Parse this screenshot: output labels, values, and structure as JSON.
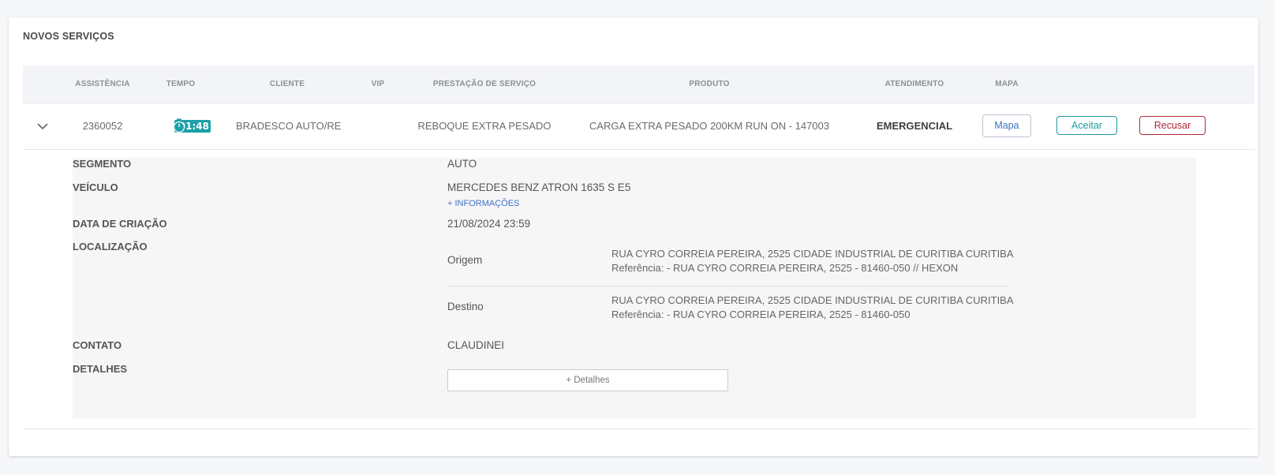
{
  "section_title": "NOVOS SERVIÇOS",
  "table": {
    "headers": {
      "assistencia": "ASSISTÊNCIA",
      "tempo": "TEMPO",
      "cliente": "CLIENTE",
      "vip": "VIP",
      "prestacao": "PRESTAÇÃO DE SERVIÇO",
      "produto": "PRODUTO",
      "atendimento": "ATENDIMENTO",
      "mapa": "MAPA"
    },
    "row": {
      "assistencia": "2360052",
      "tempo": "01:48",
      "cliente": "BRADESCO AUTO/RE",
      "vip": "",
      "prestacao": "REBOQUE EXTRA PESADO",
      "produto": "CARGA EXTRA PESADO 200KM RUN ON - 147003",
      "atendimento": "EMERGENCIAL",
      "mapa_button": "Mapa",
      "aceitar_button": "Aceitar",
      "recusar_button": "Recusar"
    }
  },
  "details": {
    "segmento_label": "SEGMENTO",
    "segmento_value": "AUTO",
    "veiculo_label": "VEÍCULO",
    "veiculo_value": "MERCEDES BENZ ATRON 1635 S E5",
    "more_info_link": "+ INFORMAÇÕES",
    "data_criacao_label": "DATA DE CRIAÇÃO",
    "data_criacao_value": "21/08/2024 23:59",
    "localizacao_label": "LOCALIZAÇÃO",
    "origem": {
      "label": "Origem",
      "address": "RUA CYRO CORREIA PEREIRA, 2525 CIDADE INDUSTRIAL DE CURITIBA CURITIBA",
      "reference": "Referência: - RUA CYRO CORREIA PEREIRA, 2525 - 81460-050 // HEXON"
    },
    "destino": {
      "label": "Destino",
      "address": "RUA CYRO CORREIA PEREIRA, 2525 CIDADE INDUSTRIAL DE CURITIBA CURITIBA",
      "reference": "Referência: - RUA CYRO CORREIA PEREIRA, 2525 - 81460-050"
    },
    "contato_label": "CONTATO",
    "contato_value": "CLAUDINEI",
    "detalhes_label": "DETALHES",
    "detalhes_button": "+ Detalhes"
  },
  "colors": {
    "accent_teal": "#1aa0a6",
    "link_blue": "#3e73c8",
    "danger_red": "#b0283a"
  },
  "icons": {
    "expand": "chevron-down-icon",
    "timer": "stopwatch-icon"
  }
}
